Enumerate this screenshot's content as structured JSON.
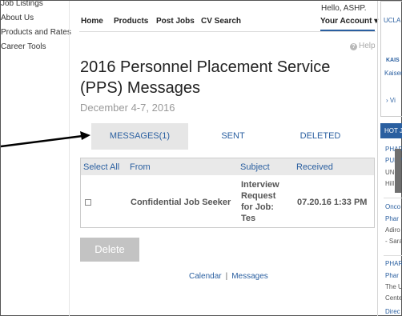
{
  "left_nav": {
    "items": [
      "Job Listings",
      "About Us",
      "Products and Rates",
      "Career Tools"
    ]
  },
  "header": {
    "greeting": "Hello, ASHP.",
    "nav": [
      "Home",
      "Products",
      "Post Jobs",
      "CV Search"
    ],
    "account_label": "Your Account ▾",
    "help_label": "Help"
  },
  "page": {
    "title": "2016 Personnel Placement Service (PPS) Messages",
    "subtitle": "December 4-7, 2016"
  },
  "tabs": [
    {
      "label": "MESSAGES(1)",
      "active": true
    },
    {
      "label": "SENT",
      "active": false
    },
    {
      "label": "DELETED",
      "active": false
    }
  ],
  "messages": {
    "columns": [
      "Select All",
      "From",
      "Subject",
      "Received"
    ],
    "rows": [
      {
        "from": "Confidential Job Seeker",
        "subject_lines": [
          "Interview",
          "Request",
          "for Job:",
          "Tes"
        ],
        "received": "07.20.16 1:33 PM"
      }
    ]
  },
  "actions": {
    "delete_label": "Delete"
  },
  "footer": {
    "links": [
      "Calendar",
      "Messages"
    ],
    "separator": "|"
  },
  "right_column": {
    "fragments": [
      "UCLA",
      "KAIS",
      "Kaiser",
      "› Vi",
      "HOT J",
      "PHAR",
      "PULM",
      "UNC I",
      "Hill",
      "Onco",
      "Phar",
      "Adiro",
      "- Sara",
      "PHAR",
      "Phar",
      "The U",
      "Cente",
      "Direc"
    ]
  },
  "colors": {
    "link_blue": "#2a5fa0",
    "active_tab_bg": "#e6e6e6",
    "button_gray": "#c3c3c3"
  }
}
